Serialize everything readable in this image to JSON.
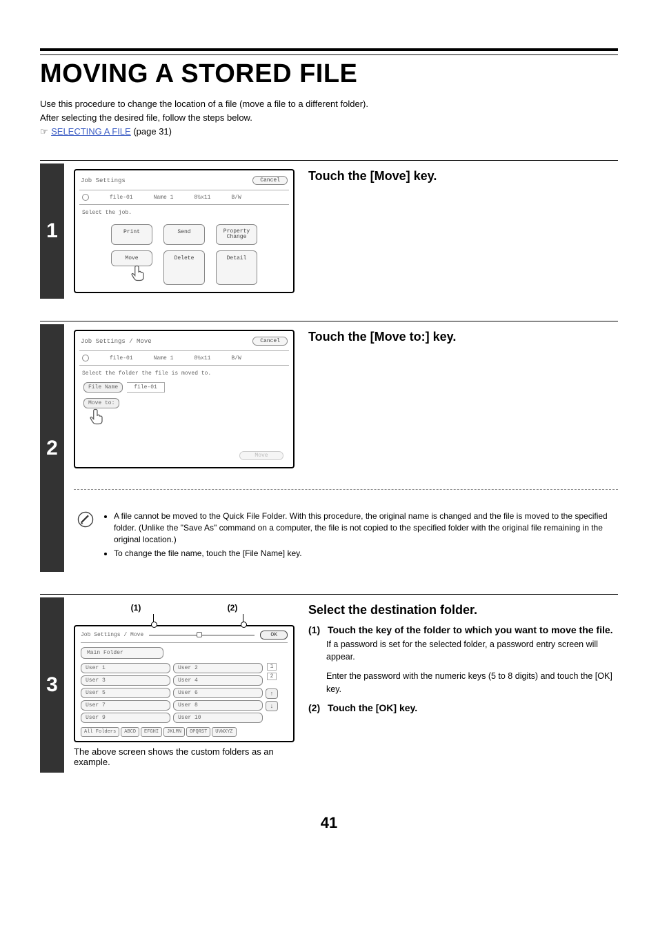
{
  "title": "MOVING A STORED FILE",
  "intro_line1": "Use this procedure to change the location of a file (move a file to a different folder).",
  "intro_line2": "After selecting the desired file, follow the steps below.",
  "link_text": "SELECTING A FILE",
  "link_page": " (page 31)",
  "pointer_glyph": "☞",
  "step1": {
    "num": "1",
    "heading": "Touch the [Move] key.",
    "screen": {
      "title": "Job Settings",
      "cancel": "Cancel",
      "file": "file-01",
      "name": "Name 1",
      "size": "8½x11",
      "color": "B/W",
      "select_label": "Select the job.",
      "btn_print": "Print",
      "btn_send": "Send",
      "btn_prop": "Property\nChange",
      "btn_move": "Move",
      "btn_delete": "Delete",
      "btn_detail": "Detail"
    }
  },
  "step2": {
    "num": "2",
    "heading": "Touch the [Move to:] key.",
    "screen": {
      "title": "Job Settings / Move",
      "cancel": "Cancel",
      "file": "file-01",
      "name": "Name 1",
      "size": "8½x11",
      "color": "B/W",
      "select_label": "Select the folder the file is moved to.",
      "filename_label": "File Name",
      "filename_value": "file-01",
      "moveto_label": "Move to:",
      "btn_move": "Move"
    },
    "note1": "A file cannot be moved to the Quick File Folder. With this procedure, the original name is changed and the file is moved to the specified folder. (Unlike the \"Save As\" command on a computer, the file is not copied to the specified folder with the original file remaining in the original location.)",
    "note2": "To change the file name, touch the [File Name] key."
  },
  "step3": {
    "num": "3",
    "heading": "Select the destination folder.",
    "callout1": "(1)",
    "callout2": "(2)",
    "screen": {
      "title": "Job Settings / Move",
      "ok": "OK",
      "main_folder": "Main Folder",
      "users_left": [
        "User 1",
        "User 3",
        "User 5",
        "User 7",
        "User 9"
      ],
      "users_right": [
        "User 2",
        "User 4",
        "User 6",
        "User 8",
        "User 10"
      ],
      "pg1": "1",
      "pg2": "2",
      "up": "↑",
      "down": "↓",
      "tabs": [
        "All Folders",
        "ABCD",
        "EFGHI",
        "JKLMN",
        "OPQRST",
        "UVWXYZ"
      ]
    },
    "caption": "The above screen shows the custom folders as an example.",
    "sub1_num": "(1)",
    "sub1_title": "Touch the key of the folder to which you want to move the file.",
    "sub1_body1": "If a password is set for the selected folder, a password entry screen will appear.",
    "sub1_body2": "Enter the password with the numeric keys (5 to 8 digits) and touch the [OK] key.",
    "sub2_num": "(2)",
    "sub2_title": "Touch the [OK] key."
  },
  "page_number": "41"
}
